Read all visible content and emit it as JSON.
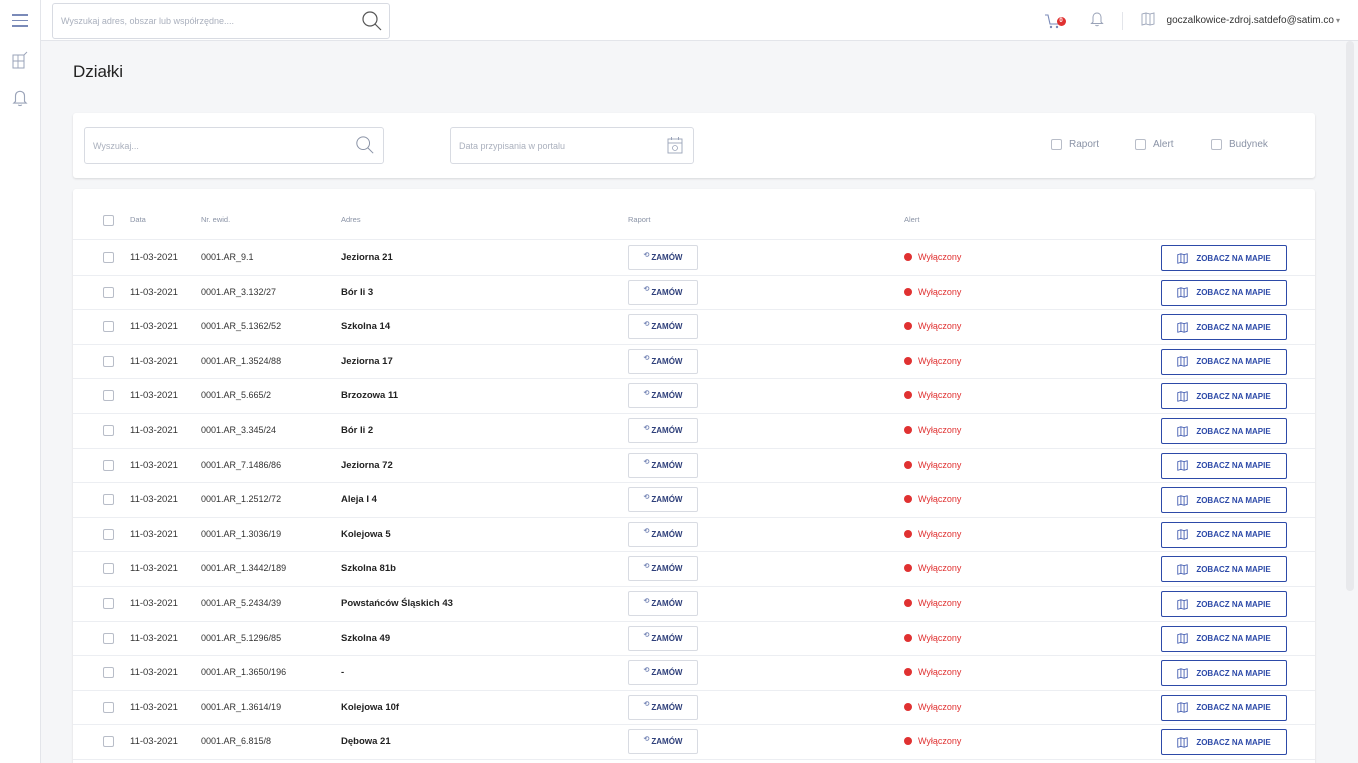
{
  "topbar": {
    "search_placeholder": "Wyszukaj adres, obszar lub współrzędne....",
    "cart_count": "0",
    "user_email": "goczalkowice-zdroj.satdefo@satim.co",
    "user_caret": "▾"
  },
  "page": {
    "title": "Działki"
  },
  "filters": {
    "search_placeholder": "Wyszukaj...",
    "date_placeholder": "Data przypisania w portalu",
    "checkboxes": [
      "Raport",
      "Alert",
      "Budynek"
    ]
  },
  "table": {
    "headers": {
      "date": "Data",
      "nr": "Nr. ewid.",
      "address": "Adres",
      "report": "Raport",
      "alert": "Alert"
    },
    "order_label": "ZAMÓW",
    "map_label": "ZOBACZ NA MAPIE",
    "rows": [
      {
        "date": "11-03-2021",
        "nr": "0001.AR_9.1",
        "address": "Jeziorna 21",
        "alert": "Wyłączony"
      },
      {
        "date": "11-03-2021",
        "nr": "0001.AR_3.132/27",
        "address": "Bór Ii 3",
        "alert": "Wyłączony"
      },
      {
        "date": "11-03-2021",
        "nr": "0001.AR_5.1362/52",
        "address": "Szkolna 14",
        "alert": "Wyłączony"
      },
      {
        "date": "11-03-2021",
        "nr": "0001.AR_1.3524/88",
        "address": "Jeziorna 17",
        "alert": "Wyłączony"
      },
      {
        "date": "11-03-2021",
        "nr": "0001.AR_5.665/2",
        "address": "Brzozowa 11",
        "alert": "Wyłączony"
      },
      {
        "date": "11-03-2021",
        "nr": "0001.AR_3.345/24",
        "address": "Bór Ii 2",
        "alert": "Wyłączony"
      },
      {
        "date": "11-03-2021",
        "nr": "0001.AR_7.1486/86",
        "address": "Jeziorna 72",
        "alert": "Wyłączony"
      },
      {
        "date": "11-03-2021",
        "nr": "0001.AR_1.2512/72",
        "address": "Aleja I 4",
        "alert": "Wyłączony"
      },
      {
        "date": "11-03-2021",
        "nr": "0001.AR_1.3036/19",
        "address": "Kolejowa 5",
        "alert": "Wyłączony"
      },
      {
        "date": "11-03-2021",
        "nr": "0001.AR_1.3442/189",
        "address": "Szkolna 81b",
        "alert": "Wyłączony"
      },
      {
        "date": "11-03-2021",
        "nr": "0001.AR_5.2434/39",
        "address": "Powstańców Śląskich 43",
        "alert": "Wyłączony"
      },
      {
        "date": "11-03-2021",
        "nr": "0001.AR_5.1296/85",
        "address": "Szkolna 49",
        "alert": "Wyłączony"
      },
      {
        "date": "11-03-2021",
        "nr": "0001.AR_1.3650/196",
        "address": "-",
        "alert": "Wyłączony"
      },
      {
        "date": "11-03-2021",
        "nr": "0001.AR_1.3614/19",
        "address": "Kolejowa 10f",
        "alert": "Wyłączony"
      },
      {
        "date": "11-03-2021",
        "nr": "0001.AR_6.815/8",
        "address": "Dębowa 21",
        "alert": "Wyłączony"
      }
    ]
  },
  "colors": {
    "accent": "#2d4aa8",
    "alert_red": "#e03131",
    "muted": "#8a93a6"
  }
}
